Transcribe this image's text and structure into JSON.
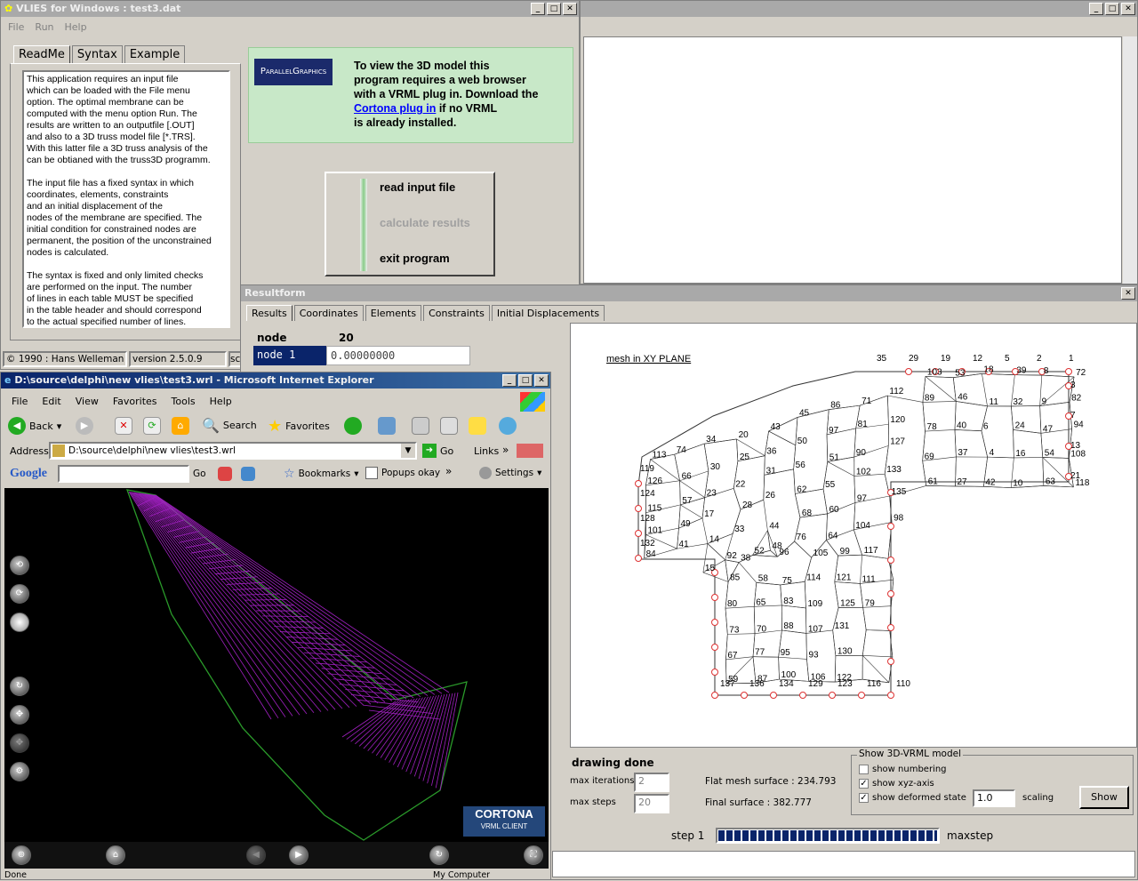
{
  "vlies": {
    "title": "VLIES for Windows : test3.dat",
    "menu": [
      "File",
      "Run",
      "Help"
    ],
    "tabs": [
      "ReadMe",
      "Syntax",
      "Example"
    ],
    "readme": "This application requires an input file\nwhich can be loaded with the File menu\noption. The optimal membrane can be\ncomputed with the menu option Run. The\nresults are written to an outputfile [.OUT]\nand also to a 3D truss model file [*.TRS].\nWith this latter file a 3D truss analysis of the\ncan be obtianed with the truss3D programm.\n\nThe input file has a fixed syntax in which\ncoordinates, elements, constraints\nand an initial displacement of the\nnodes of the membrane are specified. The\ninitial condition for constrained nodes are\npermanent, the position of the unconstrained\nnodes is calculated.\n\nThe syntax is fixed and only limited checks\nare performed on the input. The number\nof lines in each table MUST be specified\nin the table header and should correspond\nto the actual specified number of lines.",
    "logo_text": "ParallelGraphics",
    "vrml_notice_1": "To view the 3D model this",
    "vrml_notice_2": "program requires a web browser",
    "vrml_notice_3": "with a VRML plug in. Download the",
    "vrml_link": "Cortona plug in",
    "vrml_notice_4": " if no VRML",
    "vrml_notice_5": "is already installed.",
    "btn_read": "read input file",
    "btn_calc": "calculate results",
    "btn_exit": "exit program",
    "status_copy": "© 1990 : Hans Welleman",
    "status_version": "version 2.5.0.9",
    "status_extra": "sc"
  },
  "resultform": {
    "title": "Resultform",
    "tabs": [
      "Results",
      "Coordinates",
      "Elements",
      "Constraints",
      "Initial Displacements"
    ],
    "node_label": "node",
    "node_count": "20",
    "node_sel": "node 1",
    "node_val": "0.00000000",
    "mesh_title": "mesh in XY PLANE",
    "drawing_done": "drawing done",
    "max_iter_label": "max iterations",
    "max_iter_val": "2",
    "max_steps_label": "max steps",
    "max_steps_val": "20",
    "flat_surface": "Flat mesh surface : 234.793",
    "final_surface": "Final surface : 382.777",
    "group_title": "Show 3D-VRML model",
    "chk_numbering": "show numbering",
    "chk_xyz": "show xyz-axis",
    "chk_deformed": "show deformed state",
    "scaling_val": "1.0",
    "scaling_label": "scaling",
    "show_btn": "Show",
    "step_label": "step 1",
    "maxstep_label": "maxstep",
    "progress": 1.0
  },
  "ie": {
    "title": "D:\\source\\delphi\\new vlies\\test3.wrl - Microsoft Internet Explorer",
    "menu": [
      "File",
      "Edit",
      "View",
      "Favorites",
      "Tools",
      "Help"
    ],
    "back": "Back",
    "search": "Search",
    "favorites": "Favorites",
    "address_label": "Address",
    "address": "D:\\source\\delphi\\new vlies\\test3.wrl",
    "go": "Go",
    "links": "Links",
    "google": "Google",
    "google_go": "Go",
    "bookmarks": "Bookmarks",
    "popups": "Popups okay",
    "settings": "Settings",
    "cortona_1": "CORTONA",
    "cortona_2": "VRML CLIENT",
    "status_left": "Done",
    "status_right": "My Computer"
  },
  "mesh_labels": {
    "top": [
      "35",
      "29",
      "19",
      "12",
      "5",
      "2",
      "1"
    ],
    "left": [
      "119",
      "124",
      "128",
      "132"
    ],
    "bottom": [
      "137",
      "136",
      "134",
      "129",
      "123",
      "116",
      "110"
    ],
    "right": [
      "3",
      "7",
      "13",
      "21"
    ],
    "inner": [
      "103",
      "89",
      "78",
      "69",
      "61",
      "53",
      "46",
      "40",
      "37",
      "27",
      "18",
      "11",
      "6",
      "4",
      "42",
      "39",
      "32",
      "24",
      "16",
      "10",
      "8",
      "9",
      "47",
      "54",
      "63",
      "72",
      "82",
      "94",
      "108",
      "118",
      "113",
      "126",
      "115",
      "101",
      "84",
      "74",
      "66",
      "57",
      "49",
      "41",
      "34",
      "30",
      "23",
      "17",
      "14",
      "15",
      "20",
      "25",
      "22",
      "28",
      "33",
      "38",
      "43",
      "36",
      "31",
      "26",
      "44",
      "48",
      "45",
      "50",
      "56",
      "62",
      "68",
      "76",
      "86",
      "97",
      "51",
      "55",
      "60",
      "64",
      "71",
      "81",
      "90",
      "102",
      "97",
      "104",
      "112",
      "120",
      "127",
      "133",
      "135",
      "98",
      "92",
      "85",
      "80",
      "73",
      "67",
      "59",
      "52",
      "58",
      "65",
      "70",
      "77",
      "87",
      "96",
      "75",
      "83",
      "88",
      "95",
      "100",
      "105",
      "114",
      "109",
      "107",
      "93",
      "106",
      "99",
      "121",
      "125",
      "131",
      "130",
      "122",
      "117",
      "111",
      "79"
    ]
  }
}
